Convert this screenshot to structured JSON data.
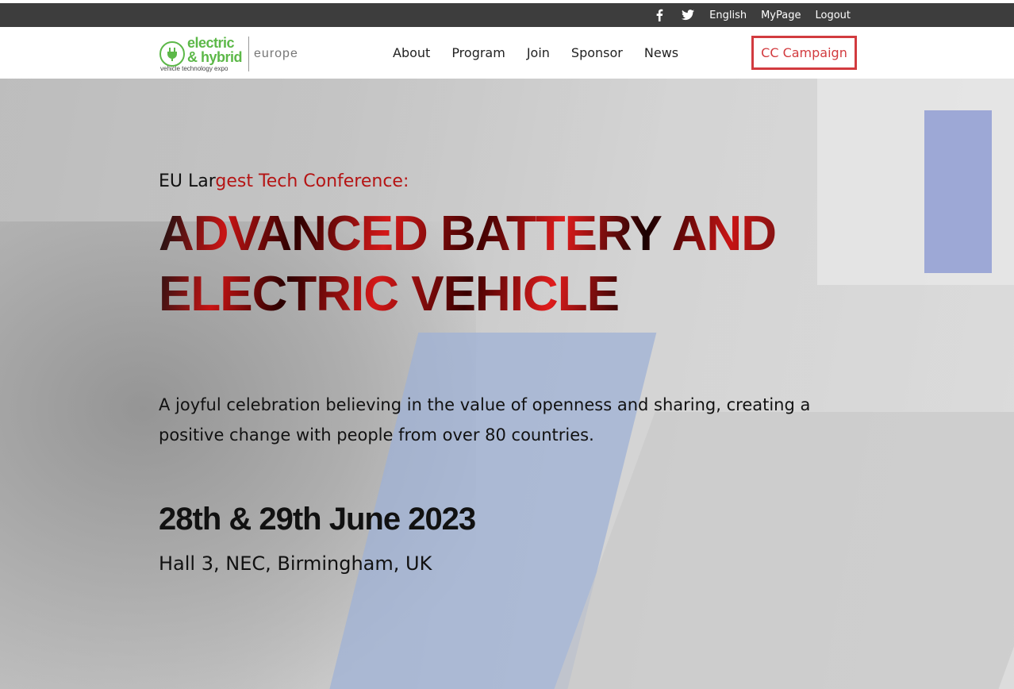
{
  "utility_bar": {
    "icons": [
      "facebook-icon",
      "twitter-icon"
    ],
    "links": [
      "English",
      "MyPage",
      "Logout"
    ]
  },
  "logo": {
    "line1": "electric",
    "line2": "& hybrid",
    "line3": "vehicle technology expo",
    "region": "europe"
  },
  "nav": {
    "links": [
      "About",
      "Program",
      "Join",
      "Sponsor",
      "News"
    ],
    "cta": "CC Campaign"
  },
  "hero": {
    "eyebrow_prefix": "EU Lar",
    "eyebrow_highlight": "gest Tech Conference:",
    "headline_line1": "ADVANCED BATTERY AND",
    "headline_line2": "ELECTRIC VEHICLE",
    "tagline": "A joyful celebration believing in the value of openness and sharing, creating a positive change with people from over 80 countries.",
    "dates": "28th & 29th June 2023",
    "venue": "Hall 3, NEC, Birmingham, UK"
  },
  "colors": {
    "utility_bar": "#3d3d3d",
    "brand_green": "#5cb848",
    "accent_red": "#d23b3f"
  }
}
